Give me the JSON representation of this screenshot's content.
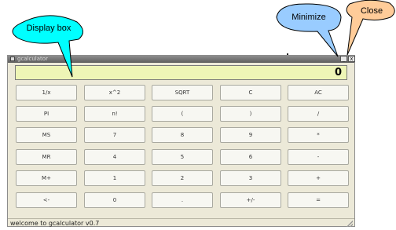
{
  "window": {
    "title": "gcalculator",
    "minimize_glyph": "_",
    "close_glyph": "x"
  },
  "display": {
    "value": "0"
  },
  "keypad": {
    "rows": [
      [
        "1/x",
        "x^2",
        "SQRT",
        "C",
        "AC"
      ],
      [
        "PI",
        "n!",
        "(",
        ")",
        "/"
      ],
      [
        "MS",
        "7",
        "8",
        "9",
        "*"
      ],
      [
        "MR",
        "4",
        "5",
        "6",
        "-"
      ],
      [
        "M+",
        "1",
        "2",
        "3",
        "+"
      ],
      [
        "<-",
        "0",
        ".",
        "+/-",
        "="
      ]
    ]
  },
  "status": {
    "text": "welcome to gcalculator v0.7"
  },
  "annotations": {
    "display_box": {
      "label": "Display box",
      "color": "#00ffff"
    },
    "minimize": {
      "label": "Minimize",
      "color": "#99ccff"
    },
    "close": {
      "label": "Close",
      "color": "#ffcc99"
    }
  }
}
